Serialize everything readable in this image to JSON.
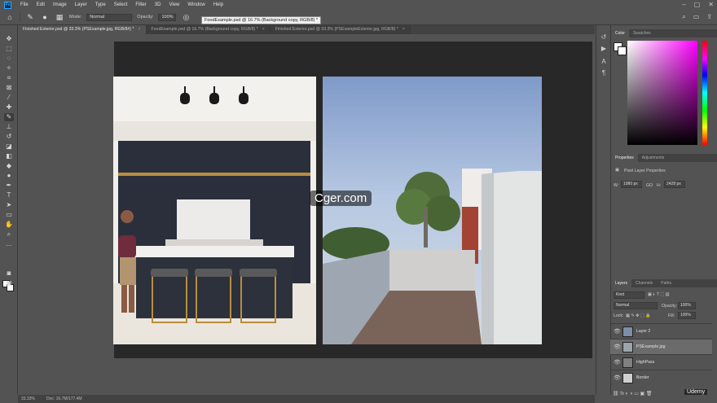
{
  "menu": [
    "File",
    "Edit",
    "Image",
    "Layer",
    "Type",
    "Select",
    "Filter",
    "3D",
    "View",
    "Window",
    "Help"
  ],
  "app_logo": "Ps",
  "options": {
    "mode_label": "Mode:",
    "mode_value": "Normal",
    "opacity_label": "Opacity:",
    "opacity_value": "100%"
  },
  "tooltip": "FoodExample.psd @ 16.7% (Background copy, RGB/8) *",
  "tabs": [
    {
      "label": "Finished Exterior.psd @ 33.3% (PSExample.jpg, RGB/8#) *",
      "active": true
    },
    {
      "label": "FoodExample.psd @ 16.7% (Background copy, RGB/8) *",
      "active": false
    },
    {
      "label": "Finished Exterior.psd @ 33.3% (PSExampleExterior.jpg, RGB/8) *",
      "active": false
    }
  ],
  "watermark": "Cger.com",
  "panels": {
    "color_tabs": [
      "Color",
      "Swatches"
    ],
    "properties_tabs": [
      "Properties",
      "Adjustments"
    ],
    "properties_title": "Pixel Layer Properties",
    "w_label": "W:",
    "w_value": "1980 px",
    "link_label": "GO",
    "h_label": "H:",
    "h_value": "2428 px",
    "layers_tabs": [
      "Layers",
      "Channels",
      "Paths"
    ],
    "kind_value": "Kind",
    "blend_value": "Normal",
    "opacity_label": "Opacity:",
    "opacity_value": "100%",
    "lock_label": "Lock:",
    "fill_label": "Fill:",
    "fill_value": "100%",
    "layers": [
      {
        "name": "Layer 2",
        "selected": false,
        "thumb": "#7d8fa8"
      },
      {
        "name": "PSExample.jpg",
        "selected": true,
        "thumb": "#9aa4ad"
      },
      {
        "name": "HighPass",
        "selected": false,
        "thumb": "#808080"
      },
      {
        "name": "Border",
        "selected": false,
        "thumb": "#cfcfcf"
      }
    ]
  },
  "status": {
    "zoom": "33.33%",
    "doc": "Doc: 16.7M/177.4M"
  },
  "udemy": "Udemy",
  "colors": {
    "accent": "#31a8ff",
    "panel_bg": "#535353",
    "artboard": "#282828"
  }
}
